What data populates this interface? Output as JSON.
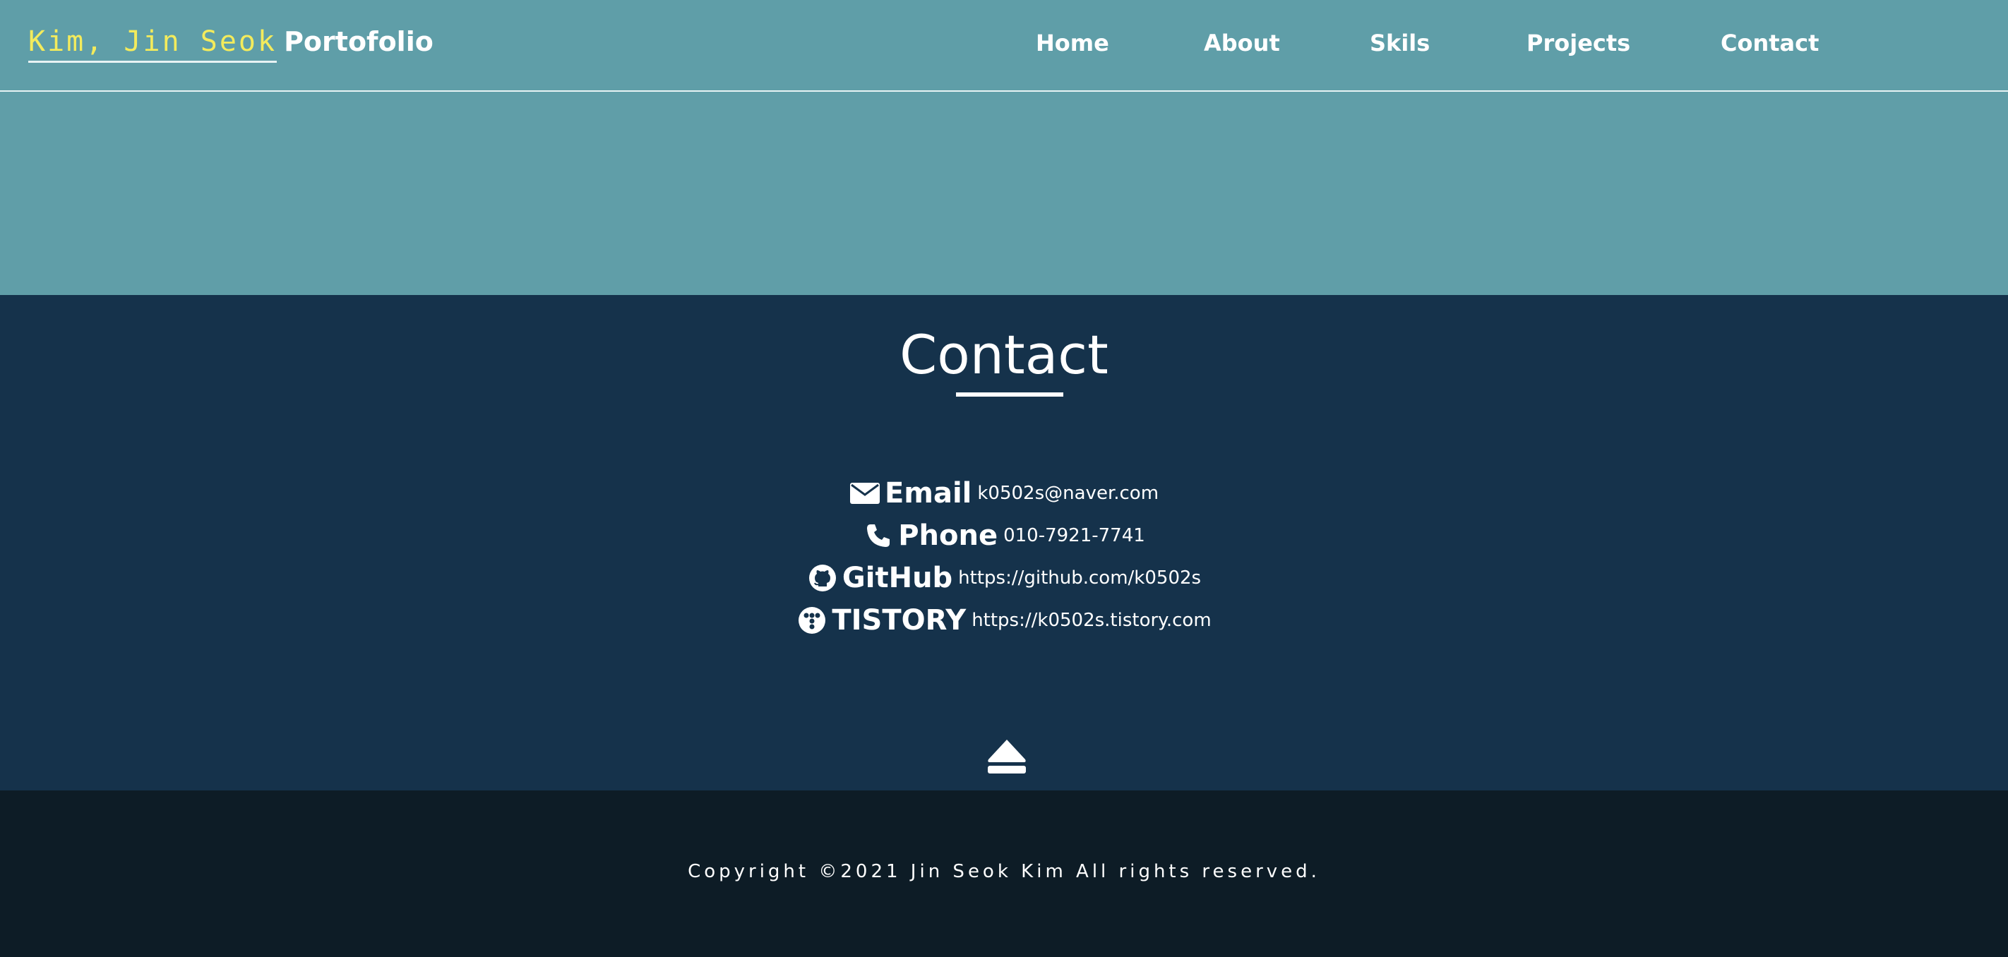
{
  "header": {
    "logo_name": "Kim, Jin Seok",
    "logo_suffix": "Portofolio",
    "nav": [
      "Home",
      "About",
      "Skils",
      "Projects",
      "Contact"
    ]
  },
  "contact": {
    "title": "Contact",
    "items": [
      {
        "icon": "envelope-icon",
        "label": "Email",
        "value": "k0502s@naver.com"
      },
      {
        "icon": "phone-icon",
        "label": "Phone",
        "value": "010-7921-7741"
      },
      {
        "icon": "github-icon",
        "label": "GitHub",
        "value": "https://github.com/k0502s"
      },
      {
        "icon": "tistory-icon",
        "label": "TISTORY",
        "value": "https://k0502s.tistory.com"
      }
    ],
    "to_top_icon": "eject-icon"
  },
  "footer": {
    "copyright": "Copyright ©2021 Jin Seok Kim All rights reserved."
  },
  "colors": {
    "header_bg": "#5f9ea8",
    "contact_bg": "#15324b",
    "footer_bg": "#0d1c26",
    "logo_accent": "#f3eb5c"
  }
}
